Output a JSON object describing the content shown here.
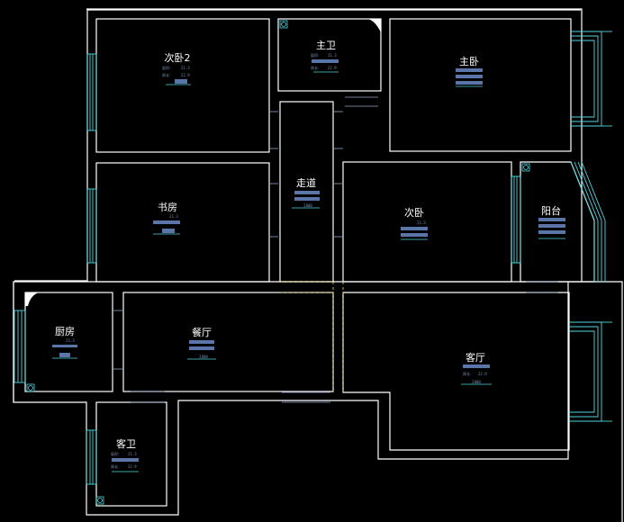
{
  "rooms": {
    "second_bedroom_2": {
      "name": "次卧2",
      "area_label": "面积：",
      "area_value": "21.3",
      "perimeter_label": "周长：",
      "perimeter_value": "22.9"
    },
    "master_bath": {
      "name": "主卫",
      "area_label": "面积：",
      "area_value": "21.3",
      "perimeter_label": "周长：",
      "perimeter_value": "22.9"
    },
    "master_bedroom": {
      "name": "主卧"
    },
    "study": {
      "name": "书房",
      "area_value": "21.3"
    },
    "corridor": {
      "name": "走道",
      "dim": "2800"
    },
    "second_bedroom": {
      "name": "次卧",
      "area_value": "21.3"
    },
    "balcony": {
      "name": "阳台"
    },
    "kitchen": {
      "name": "厨房",
      "area_value": "21.3"
    },
    "dining": {
      "name": "餐厅",
      "dim": "2800"
    },
    "living": {
      "name": "客厅",
      "perimeter_label": "周长：",
      "perimeter_value": "22.9",
      "dim": "2800"
    },
    "guest_bath": {
      "name": "客卫",
      "area_label": "面积：",
      "area_value": "21.3",
      "perimeter_label": "周长：",
      "perimeter_value": "22.9"
    }
  },
  "colors": {
    "background": "#000000",
    "wall": "#ffffff",
    "window": "#4fd8e0",
    "label_bar": "#5a76a8",
    "opening": "#e8d86a"
  }
}
